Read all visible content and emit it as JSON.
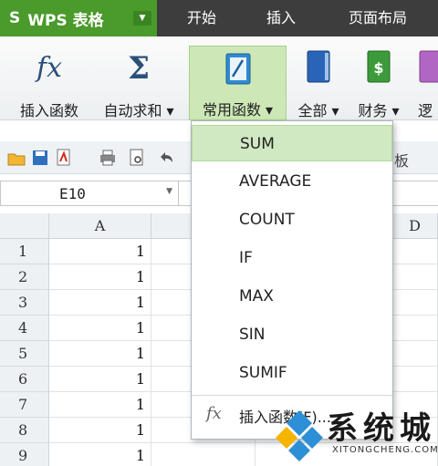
{
  "app": {
    "logo": "S",
    "name": "WPS 表格",
    "caret": "▼"
  },
  "menu": [
    "开始",
    "插入",
    "页面布局"
  ],
  "ribbon": {
    "insert_function": "插入函数",
    "autosum": "自动求和 ▾",
    "common_functions": "常用函数 ▾",
    "all": "全部 ▾",
    "finance": "财务 ▾",
    "logic": "逻"
  },
  "quickbar": {
    "clipboard_partial": "板"
  },
  "formula_bar": {
    "cell_ref": "E10"
  },
  "grid": {
    "columns": [
      "A",
      "D"
    ],
    "rows": [
      {
        "num": "1",
        "a": "1"
      },
      {
        "num": "2",
        "a": "1"
      },
      {
        "num": "3",
        "a": "1"
      },
      {
        "num": "4",
        "a": "1"
      },
      {
        "num": "5",
        "a": "1"
      },
      {
        "num": "6",
        "a": "1"
      },
      {
        "num": "7",
        "a": "1"
      },
      {
        "num": "8",
        "a": "1"
      },
      {
        "num": "9",
        "a": "1"
      }
    ]
  },
  "dropdown": {
    "items": [
      "SUM",
      "AVERAGE",
      "COUNT",
      "IF",
      "MAX",
      "SIN",
      "SUMIF"
    ],
    "selected": "SUM",
    "fx": "fx",
    "insert_label": "插入函数(F)..."
  },
  "watermark": {
    "text": "系统城",
    "sub": "XITONGCHENG.COM"
  },
  "colors": {
    "app_green": "#4a9a2c",
    "menubar": "#3d3d3d",
    "selection": "#d1e9c2"
  }
}
